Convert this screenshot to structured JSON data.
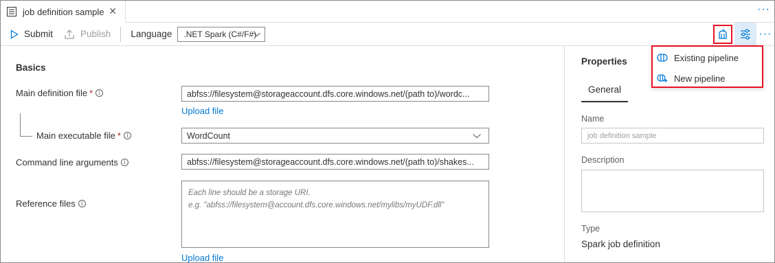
{
  "tab": {
    "title": "job definition sample",
    "close_glyph": "✕",
    "more_glyph": "···"
  },
  "toolbar": {
    "submit_label": "Submit",
    "publish_label": "Publish",
    "language_label": "Language",
    "language_value": ".NET Spark (C#/F#)",
    "more_glyph": "···",
    "icons": [
      "add-to-pipeline-icon",
      "properties-icon"
    ]
  },
  "basics": {
    "title": "Basics",
    "main_definition_label": "Main definition file",
    "main_definition_value": "abfss://filesystem@storageaccount.dfs.core.windows.net/(path to)/wordc...",
    "upload_file_label": "Upload file",
    "main_executable_label": "Main executable file",
    "main_executable_value": "WordCount",
    "command_line_label": "Command line arguments",
    "command_line_value": "abfss://filesystem@storageaccount.dfs.core.windows.net/(path to)/shakes...",
    "reference_files_label": "Reference files",
    "reference_files_placeholder_line1": "Each line should be a storage URI.",
    "reference_files_placeholder_line2": "e.g. \"abfss://filesystem@account.dfs.core.windows.net/mylibs/myUDF.dll\"",
    "upload_file_label_2": "Upload file",
    "required_mark": "*",
    "info_glyph": "i"
  },
  "properties": {
    "title": "Properties",
    "tab_general": "General",
    "name_label": "Name",
    "name_placeholder": "job definition sample",
    "description_label": "Description",
    "type_label": "Type",
    "type_value": "Spark job definition"
  },
  "pipeline_menu": {
    "items": [
      {
        "label": "Existing pipeline",
        "icon": "existing-pipeline-icon"
      },
      {
        "label": "New pipeline",
        "icon": "new-pipeline-icon"
      }
    ]
  },
  "colors": {
    "accent": "#0078d4",
    "highlight": "#e81123",
    "required": "#a4262c"
  }
}
